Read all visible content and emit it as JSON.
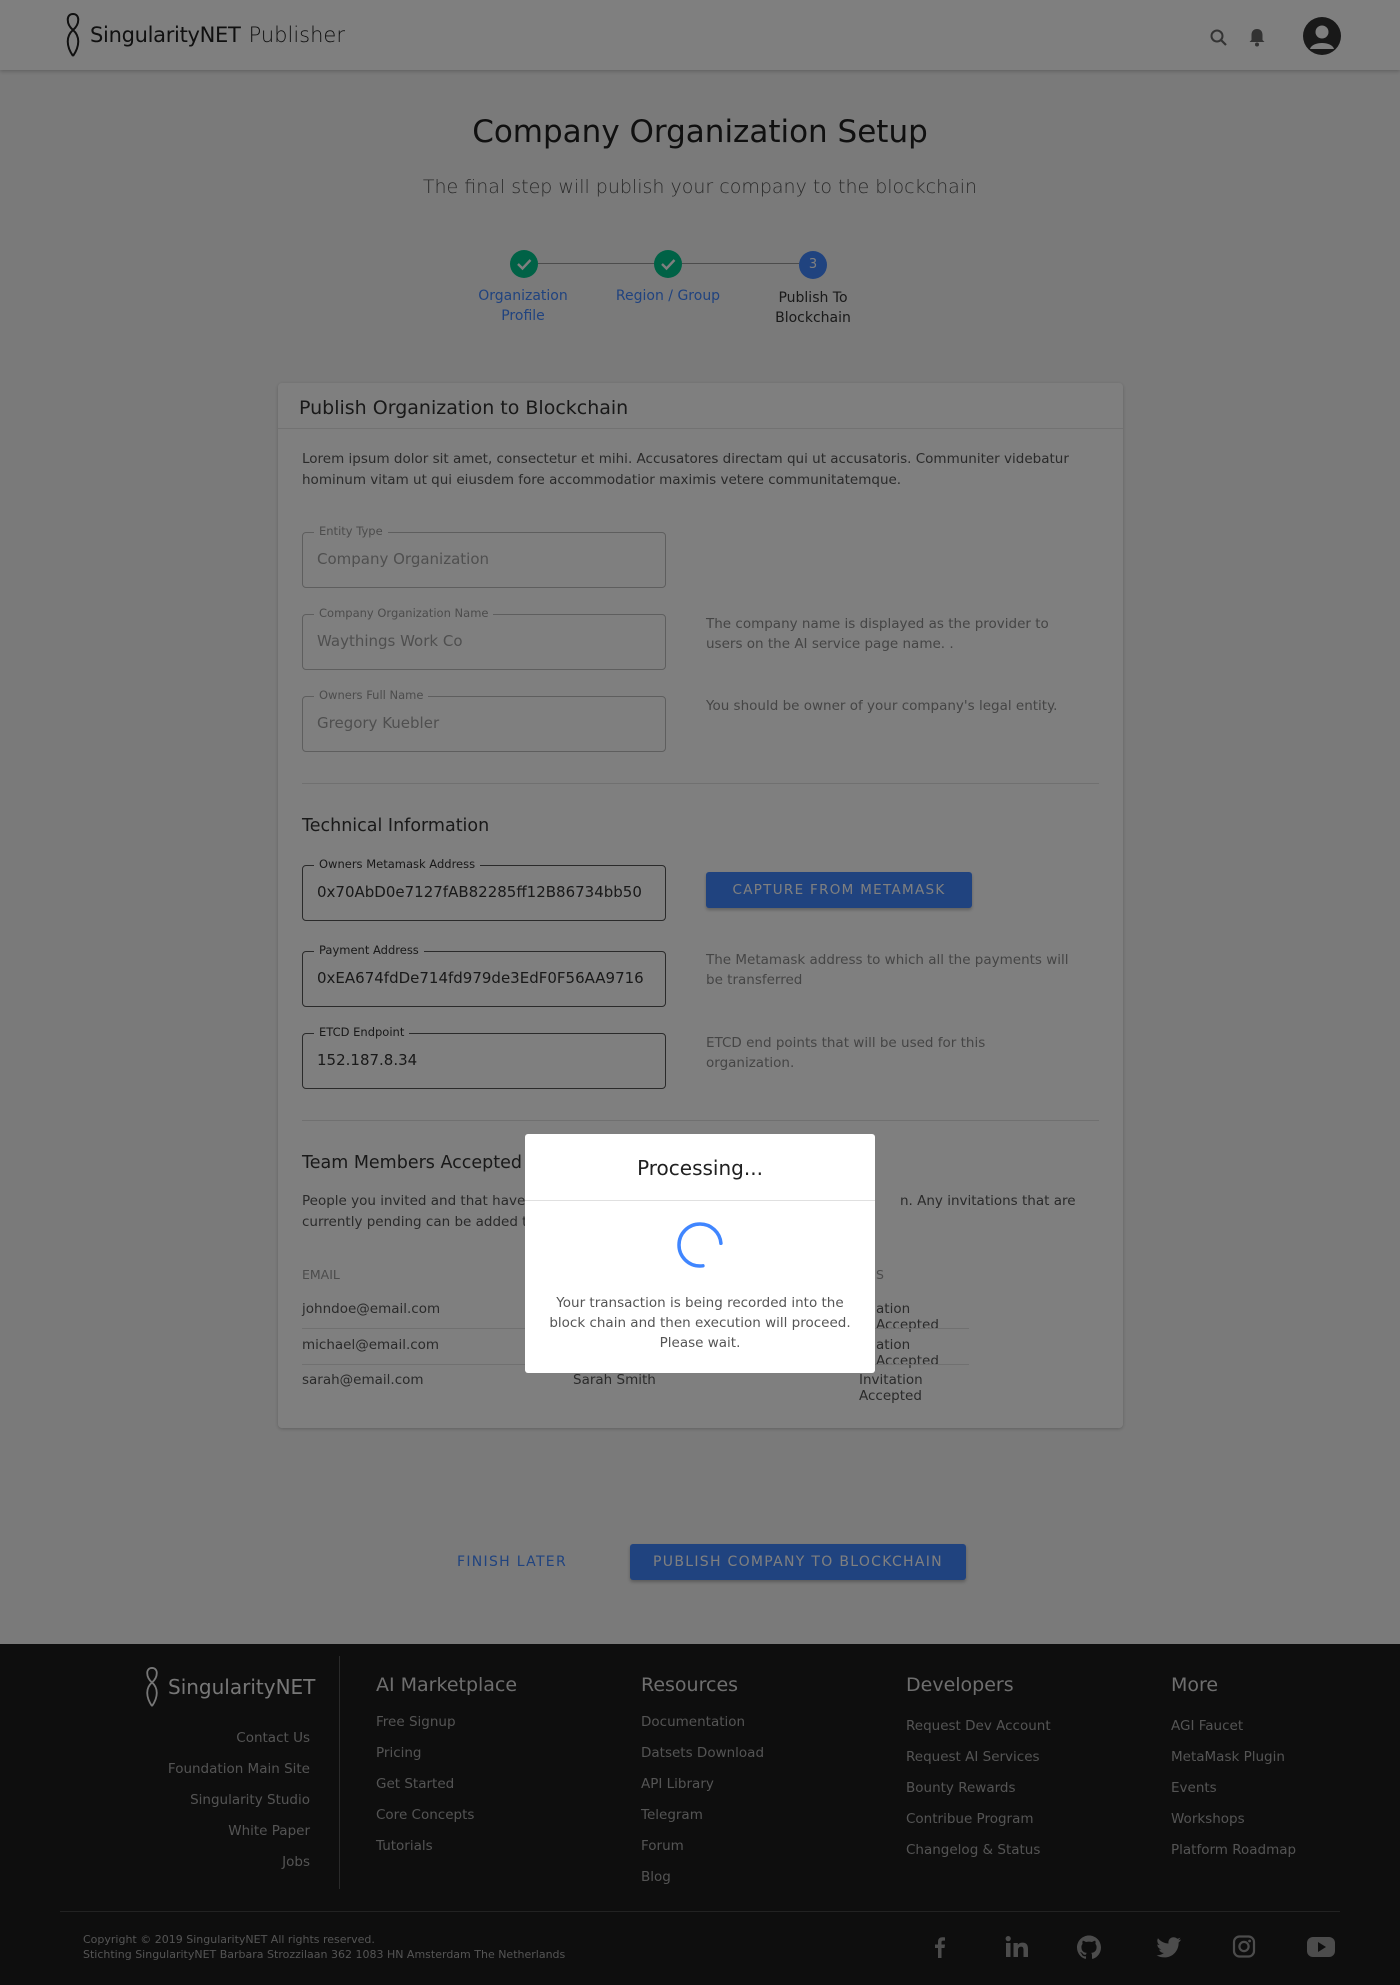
{
  "header": {
    "brand": "SingularityNET",
    "product": "Publisher",
    "icons": [
      "search-icon",
      "bell-icon",
      "account-icon"
    ]
  },
  "page": {
    "title": "Company Organization Setup",
    "subtitle": "The final step will publish your company to the blockchain"
  },
  "stepper": {
    "steps": [
      {
        "label_line1": "Organization",
        "label_line2": "Profile",
        "status": "done"
      },
      {
        "label_line1": "Region / Group",
        "label_line2": "",
        "status": "done"
      },
      {
        "label_line1": "Publish To",
        "label_line2": "Blockchain",
        "status": "active",
        "number": "3"
      }
    ]
  },
  "card": {
    "title": "Publish Organization to Blockchain",
    "description": "Lorem ipsum dolor sit amet, consectetur et mihi. Accusatores directam qui ut accusatoris. Communiter videbatur hominum vitam ut qui eiusdem fore accommodatior maximis vetere communitatemque.",
    "fields": {
      "entity_type": {
        "label": "Entity Type",
        "value": "Company Organization"
      },
      "company_name": {
        "label": "Company Organization Name",
        "value": "Waythings Work Co",
        "hint": "The company name is displayed as the provider to users on the AI service page name. ."
      },
      "owner_name": {
        "label": "Owners Full Name",
        "value": "Gregory Kuebler",
        "hint": "You should be owner of your company's legal entity."
      }
    },
    "technical": {
      "title": "Technical Information",
      "metamask": {
        "label": "Owners Metamask Address",
        "value": "0x70AbD0e7127fAB82285ff12B86734bb50"
      },
      "capture_button": "CAPTURE FROM METAMASK",
      "payment": {
        "label": "Payment Address",
        "value": "0xEA674fdDe714fd979de3EdF0F56AA9716",
        "hint": "The Metamask address to which all the payments will be transferred"
      },
      "etcd": {
        "label": "ETCD Endpoint",
        "value": "152.187.8.34",
        "hint": " ETCD end points that will be used for this organization."
      }
    },
    "team": {
      "title": "Team Members Accepted In",
      "desc_line1_left": "People you invited and that have a",
      "desc_line1_right": "n.  Any invitations that are",
      "desc_line2": "currently pending can be added to",
      "columns": {
        "email": "EMAIL",
        "status": "S"
      },
      "rows": [
        {
          "email": "johndoe@email.com",
          "name": "",
          "status": "ation Accepted"
        },
        {
          "email": "michael@email.com",
          "name": "",
          "status": "ation Accepted"
        },
        {
          "email": "sarah@email.com",
          "name": "Sarah Smith",
          "status": "Invitation Accepted"
        }
      ]
    }
  },
  "actions": {
    "finish_later": "FINISH LATER",
    "publish": "PUBLISH COMPANY TO BLOCKCHAIN"
  },
  "modal": {
    "title": "Processing...",
    "message": "Your transaction is being recorded into the block chain and then execution will proceed. Please wait."
  },
  "footer": {
    "brand": "SingularityNET",
    "left_links": [
      "Contact Us",
      "Foundation Main Site",
      "Singularity Studio",
      "White Paper",
      "Jobs"
    ],
    "columns": [
      {
        "title": "AI Marketplace",
        "links": [
          "Free Signup",
          "Pricing",
          "Get Started",
          "Core Concepts",
          "Tutorials"
        ]
      },
      {
        "title": "Resources",
        "links": [
          "Documentation",
          "Datsets Download",
          "API Library",
          "Telegram",
          "Forum",
          "Blog"
        ]
      },
      {
        "title": "Developers",
        "links": [
          "Request Dev Account",
          "Request AI Services",
          "Bounty Rewards",
          "Contribue Program",
          "Changelog & Status"
        ]
      },
      {
        "title": "More",
        "links": [
          "AGI Faucet",
          "MetaMask Plugin",
          "Events",
          "Workshops",
          "Platform Roadmap"
        ]
      }
    ],
    "copyright_line1": "Copyright © 2019 SingularityNET All rights reserved.",
    "copyright_line2": "Stichting SingularityNET Barbara Strozzilaan 362 1083 HN Amsterdam The Netherlands",
    "social_icons": [
      "facebook-icon",
      "linkedin-icon",
      "github-icon",
      "twitter-icon",
      "instagram-icon",
      "youtube-icon"
    ]
  }
}
